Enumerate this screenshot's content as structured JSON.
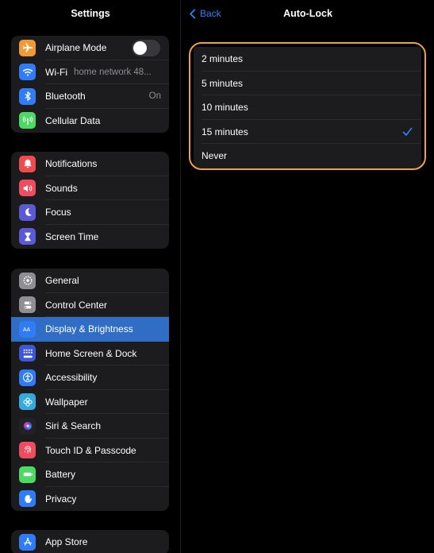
{
  "sidebar": {
    "title": "Settings",
    "groups": [
      {
        "items": [
          {
            "label": "Airplane Mode",
            "icon": "airplane-icon",
            "color": "#f09a37",
            "toggle": false
          },
          {
            "label": "Wi-Fi",
            "icon": "wifi-icon",
            "color": "#2f7cf6",
            "value": "home network 48..."
          },
          {
            "label": "Bluetooth",
            "icon": "bluetooth-icon",
            "color": "#2f7cf6",
            "value": "On"
          },
          {
            "label": "Cellular Data",
            "icon": "cellular-icon",
            "color": "#4cd964"
          }
        ]
      },
      {
        "items": [
          {
            "label": "Notifications",
            "icon": "bell-icon",
            "color": "#ee4c4c"
          },
          {
            "label": "Sounds",
            "icon": "speaker-icon",
            "color": "#ee4c5f"
          },
          {
            "label": "Focus",
            "icon": "moon-icon",
            "color": "#5b5ad6"
          },
          {
            "label": "Screen Time",
            "icon": "hourglass-icon",
            "color": "#5b5ad6"
          }
        ]
      },
      {
        "items": [
          {
            "label": "General",
            "icon": "gear-icon",
            "color": "#8e8e93"
          },
          {
            "label": "Control Center",
            "icon": "switches-icon",
            "color": "#8e8e93"
          },
          {
            "label": "Display & Brightness",
            "icon": "text-size-icon",
            "color": "#2f7cf6",
            "selected": true
          },
          {
            "label": "Home Screen & Dock",
            "icon": "home-grid-icon",
            "color": "#3d57d8"
          },
          {
            "label": "Accessibility",
            "icon": "accessibility-icon",
            "color": "#2f7cf6"
          },
          {
            "label": "Wallpaper",
            "icon": "flower-icon",
            "color": "#37aadc"
          },
          {
            "label": "Siri & Search",
            "icon": "siri-icon",
            "color": "#222222"
          },
          {
            "label": "Touch ID & Passcode",
            "icon": "fingerprint-icon",
            "color": "#ee4c5f"
          },
          {
            "label": "Battery",
            "icon": "battery-icon",
            "color": "#4cd964"
          },
          {
            "label": "Privacy",
            "icon": "hand-icon",
            "color": "#2f7cf6"
          }
        ]
      },
      {
        "items": [
          {
            "label": "App Store",
            "icon": "app-store-icon",
            "color": "#2f7cf6"
          }
        ]
      }
    ]
  },
  "detail": {
    "back_label": "Back",
    "title": "Auto-Lock",
    "options": [
      {
        "label": "2 minutes",
        "checked": false
      },
      {
        "label": "5 minutes",
        "checked": false
      },
      {
        "label": "10 minutes",
        "checked": false
      },
      {
        "label": "15 minutes",
        "checked": true
      },
      {
        "label": "Never",
        "checked": false
      }
    ],
    "check_color": "#2f83f5",
    "highlight_color": "#f2a044"
  }
}
